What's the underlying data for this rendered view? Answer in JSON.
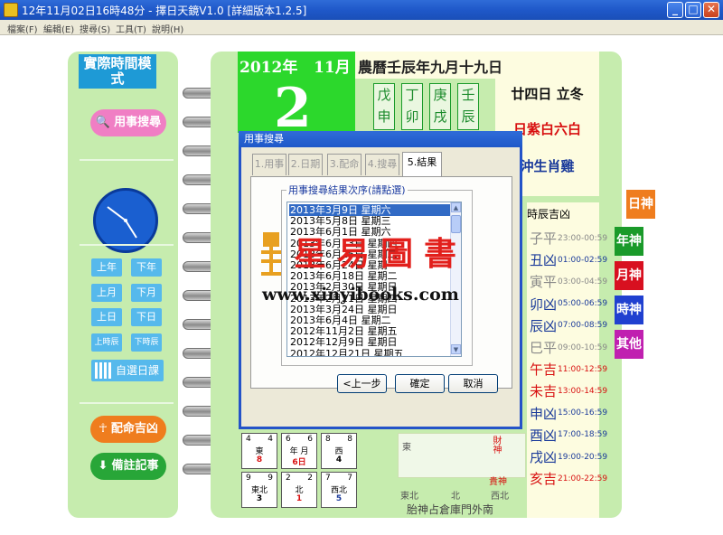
{
  "window": {
    "title": "12年11月02日16時48分 - 擇日天鏡V1.0 [詳細版本1.2.5]",
    "min_label": "_",
    "max_label": "□",
    "close_label": "✕"
  },
  "menu": {
    "items": [
      "檔案(F)",
      "編輯(E)",
      "搜尋(S)",
      "工具(T)",
      "說明(H)"
    ]
  },
  "left": {
    "mode_label": "實際時間模式",
    "search_button": "用事搜尋",
    "nav": {
      "prev_year": "上年",
      "next_year": "下年",
      "prev_month": "上月",
      "next_month": "下月",
      "prev_day": "上日",
      "next_day": "下日",
      "prev_hour": "上時辰",
      "next_hour": "下時辰"
    },
    "custom_calendar": "自選日課",
    "match_button": "配命吉凶",
    "memo_button": "備註記事"
  },
  "main": {
    "year": "2012年",
    "month": "11月",
    "day": "2",
    "lunar": "農曆壬辰年九月十九日",
    "ganzhi": [
      "戊申",
      "丁卯",
      "庚戌",
      "壬辰"
    ],
    "solar_term": "廿四日  立冬",
    "star": "日紫白六白",
    "clash": "沖生肖雞"
  },
  "hours": {
    "header": "時辰吉凶",
    "rows": [
      {
        "zh": "子平",
        "time": "23:00-00:59",
        "color": "#888888"
      },
      {
        "zh": "丑凶",
        "time": "01:00-02:59",
        "color": "#1a3a9a"
      },
      {
        "zh": "寅平",
        "time": "03:00-04:59",
        "color": "#888888"
      },
      {
        "zh": "卯凶",
        "time": "05:00-06:59",
        "color": "#1a3a9a"
      },
      {
        "zh": "辰凶",
        "time": "07:00-08:59",
        "color": "#1a3a9a"
      },
      {
        "zh": "巳平",
        "time": "09:00-10:59",
        "color": "#888888"
      },
      {
        "zh": "午吉",
        "time": "11:00-12:59",
        "color": "#d81010"
      },
      {
        "zh": "未吉",
        "time": "13:00-14:59",
        "color": "#d81010"
      },
      {
        "zh": "申凶",
        "time": "15:00-16:59",
        "color": "#1a3a9a"
      },
      {
        "zh": "酉凶",
        "time": "17:00-18:59",
        "color": "#1a3a9a"
      },
      {
        "zh": "戌凶",
        "time": "19:00-20:59",
        "color": "#1a3a9a"
      },
      {
        "zh": "亥吉",
        "time": "21:00-22:59",
        "color": "#d81010"
      }
    ]
  },
  "side_buttons": [
    {
      "label": "日神",
      "color": "#ef7d1e"
    },
    {
      "label": "年神",
      "color": "#1a9a2a"
    },
    {
      "label": "月神",
      "color": "#d81020"
    },
    {
      "label": "時神",
      "color": "#2040d0"
    },
    {
      "label": "其他",
      "color": "#c020b0"
    }
  ],
  "grid": {
    "cells": [
      {
        "tl": "4",
        "tr": "4",
        "mid": "東",
        "bot": "8",
        "bot_color": "#d81010"
      },
      {
        "tl": "6",
        "tr": "6",
        "mid": "年 月",
        "bot": "6日",
        "bot_color": "#d81010"
      },
      {
        "tl": "8",
        "tr": "8",
        "mid": "西",
        "bot": "4",
        "bot_color": "#000000"
      },
      {
        "tl": "9",
        "tr": "9",
        "mid": "東北",
        "bot": "3",
        "bot_color": "#000000"
      },
      {
        "tl": "2",
        "tr": "2",
        "mid": "北",
        "bot": "1",
        "bot_color": "#d81010"
      },
      {
        "tl": "7",
        "tr": "7",
        "mid": "西北",
        "bot": "5",
        "bot_color": "#1a3a9a"
      }
    ],
    "chart_labels": {
      "east": "東",
      "northeast": "東北",
      "north": "北",
      "northwest": "西北",
      "deity1": "財神",
      "deity2": "貴神"
    },
    "footer": "胎神占倉庫門外南"
  },
  "dialog": {
    "title": "用事搜尋",
    "tabs": [
      "1.用事",
      "2.日期",
      "3.配命",
      "4.搜尋",
      "5.結果"
    ],
    "group_label": "用事搜尋結果次序(請點選)",
    "results": [
      "2013年3月9日 星期六",
      "2013年5月8日 星期三",
      "2013年6月1日 星期六",
      "2013年6月13日 星期四",
      "2013年6月25日 星期二",
      "2013年6月24日 星期一",
      "2013年6月18日 星期二",
      "2013年2月30日 星期日",
      "2013年2月21日 星期四",
      "2013年3月24日 星期日",
      "2013年6月4日 星期二",
      "2012年11月2日 星期五",
      "2012年12月9日 星期日",
      "2012年12月21日 星期五"
    ],
    "prev_button": "<上一步",
    "ok_button": "確定",
    "cancel_button": "取消"
  },
  "watermark": {
    "cn": "星易圖書",
    "url": "www.xinyibooks.com"
  }
}
